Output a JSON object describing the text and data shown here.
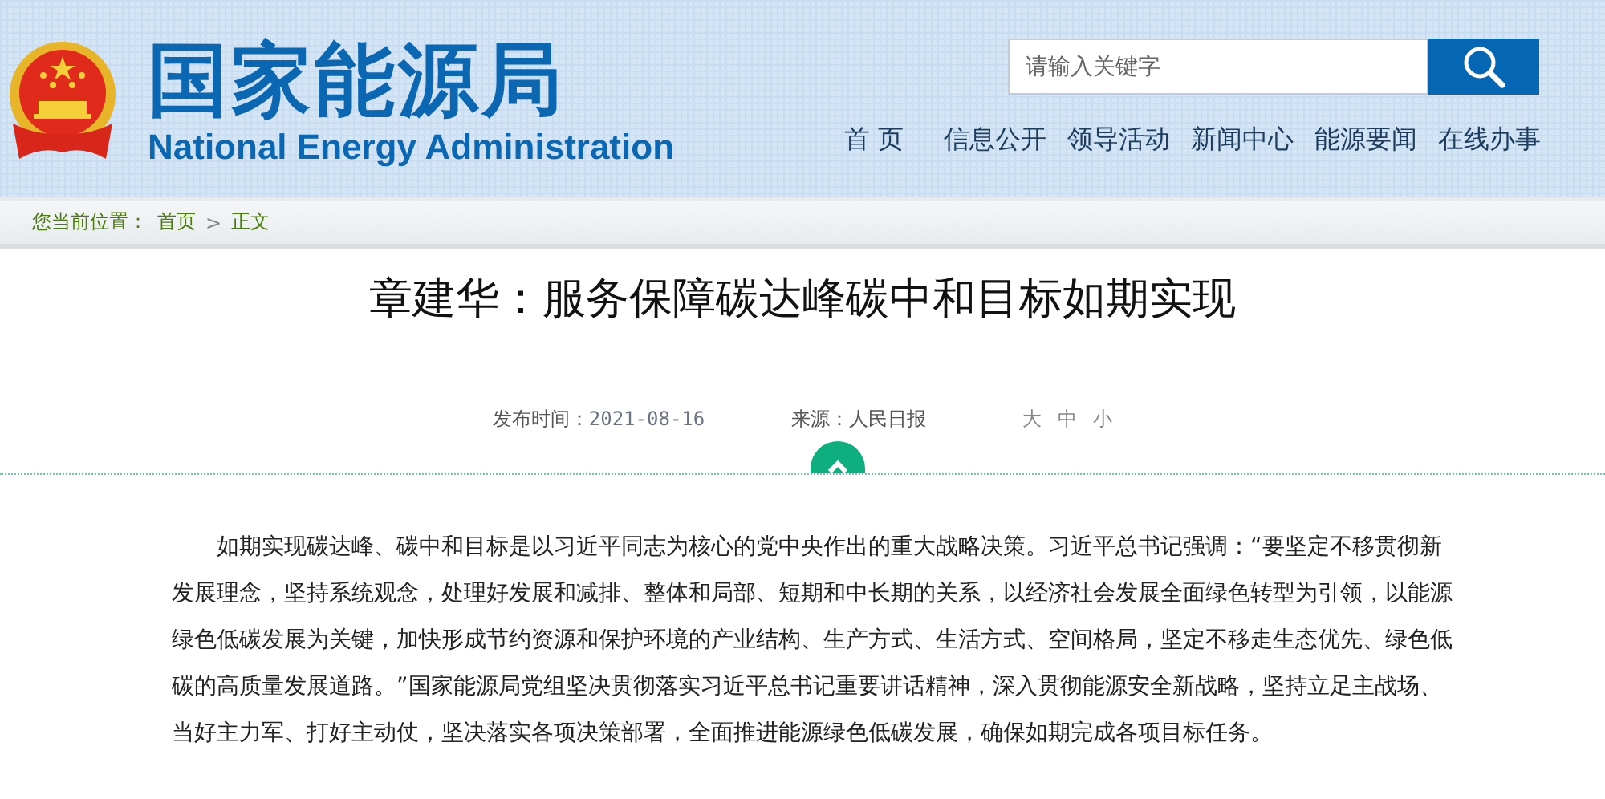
{
  "header": {
    "site_name": "国家能源局",
    "site_name_en": "National Energy Administration",
    "search": {
      "placeholder": "请输入关键字"
    },
    "nav": [
      {
        "label": "首 页"
      },
      {
        "label": "信息公开"
      },
      {
        "label": "领导活动"
      },
      {
        "label": "新闻中心"
      },
      {
        "label": "能源要闻"
      },
      {
        "label": "在线办事"
      }
    ]
  },
  "breadcrumb": {
    "label": "您当前位置：",
    "items": [
      "首页",
      "正文"
    ],
    "separator": ">"
  },
  "article": {
    "title": "章建华：服务保障碳达峰碳中和目标如期实现",
    "meta": {
      "date_label": "发布时间：",
      "date": "2021-08-16",
      "source_label": "来源：",
      "source": "人民日报",
      "font_sizes": [
        "大",
        "中",
        "小"
      ]
    },
    "paragraphs": [
      "如期实现碳达峰、碳中和目标是以习近平同志为核心的党中央作出的重大战略决策。习近平总书记强调：“要坚定不移贯彻新发展理念，坚持系统观念，处理好发展和减排、整体和局部、短期和中长期的关系，以经济社会发展全面绿色转型为引领，以能源绿色低碳发展为关键，加快形成节约资源和保护环境的产业结构、生产方式、生活方式、空间格局，坚定不移走生态优先、绿色低碳的高质量发展道路。”国家能源局党组坚决贯彻落实习近平总书记重要讲话精神，深入贯彻能源安全新战略，坚持立足主战场、当好主力军、打好主动仗，坚决落实各项决策部署，全面推进能源绿色低碳发展，确保如期完成各项目标任务。"
    ]
  }
}
